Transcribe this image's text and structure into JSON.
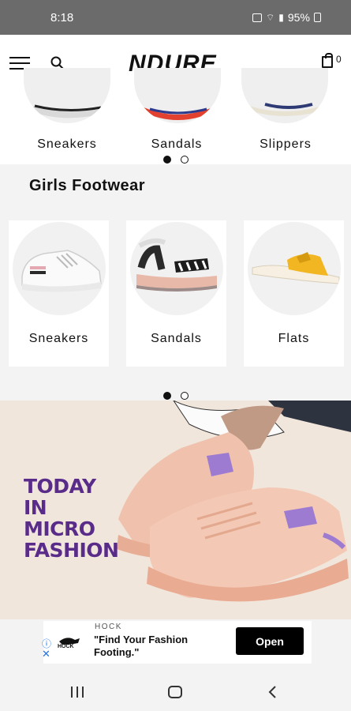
{
  "status_bar": {
    "time": "8:18",
    "battery": "95%"
  },
  "header": {
    "logo": "NDURE",
    "cart_count": "0",
    "icons": [
      "menu-icon",
      "search-icon",
      "shopping-bag-icon"
    ]
  },
  "top_categories": {
    "items": [
      {
        "label": "Sneakers"
      },
      {
        "label": "Sandals"
      },
      {
        "label": "Slippers"
      }
    ]
  },
  "girls_section": {
    "title": "Girls Footwear",
    "items": [
      {
        "label": "Sneakers"
      },
      {
        "label": "Sandals"
      },
      {
        "label": "Flats"
      }
    ]
  },
  "banner": {
    "headline": "TODAY IN MICRO FASHION"
  },
  "ad": {
    "brand": "HOCK",
    "logo_text": "HOCK",
    "text": "\"Find Your Fashion Footing.\"",
    "open_label": "Open"
  },
  "colors": {
    "banner_bg": "#f1e6dc",
    "banner_text": "#5a2c8a",
    "shoe_peach": "#f0c2ae",
    "flats_yellow": "#f2b623"
  }
}
